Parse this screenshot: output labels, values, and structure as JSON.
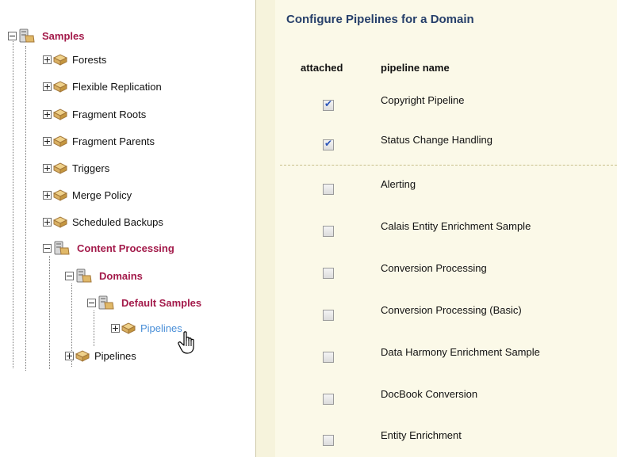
{
  "tree": {
    "root": {
      "label": "Samples",
      "expanded": true
    },
    "items": [
      {
        "label": "Forests",
        "expanded": false
      },
      {
        "label": "Flexible Replication",
        "expanded": false
      },
      {
        "label": "Fragment Roots",
        "expanded": false
      },
      {
        "label": "Fragment Parents",
        "expanded": false
      },
      {
        "label": "Triggers",
        "expanded": false
      },
      {
        "label": "Merge Policy",
        "expanded": false
      },
      {
        "label": "Scheduled Backups",
        "expanded": false
      }
    ],
    "content_processing": {
      "label": "Content Processing",
      "expanded": true
    },
    "domains": {
      "label": "Domains",
      "expanded": true
    },
    "default_samples": {
      "label": "Default Samples",
      "expanded": true
    },
    "pipelines_hover": {
      "label": "Pipelines",
      "expanded": false
    },
    "pipelines": {
      "label": "Pipelines",
      "expanded": false
    }
  },
  "panel": {
    "title": "Configure Pipelines for a Domain",
    "col_attached": "attached",
    "col_name": "pipeline name",
    "rows": [
      {
        "name": "Copyright Pipeline",
        "attached": true
      },
      {
        "name": "Status Change Handling",
        "attached": true
      },
      {
        "name": "Alerting",
        "attached": false
      },
      {
        "name": "Calais Entity Enrichment Sample",
        "attached": false
      },
      {
        "name": "Conversion Processing",
        "attached": false
      },
      {
        "name": "Conversion Processing (Basic)",
        "attached": false
      },
      {
        "name": "Data Harmony Enrichment Sample",
        "attached": false
      },
      {
        "name": "DocBook Conversion",
        "attached": false
      },
      {
        "name": "Entity Enrichment",
        "attached": false
      }
    ]
  },
  "colors": {
    "tree_bold": "#a31a4a",
    "tree_link": "#4a8fd8",
    "panel_title": "#263f6a",
    "panel_bg": "#fbf9e8",
    "checkmark": "#2a54b8"
  }
}
